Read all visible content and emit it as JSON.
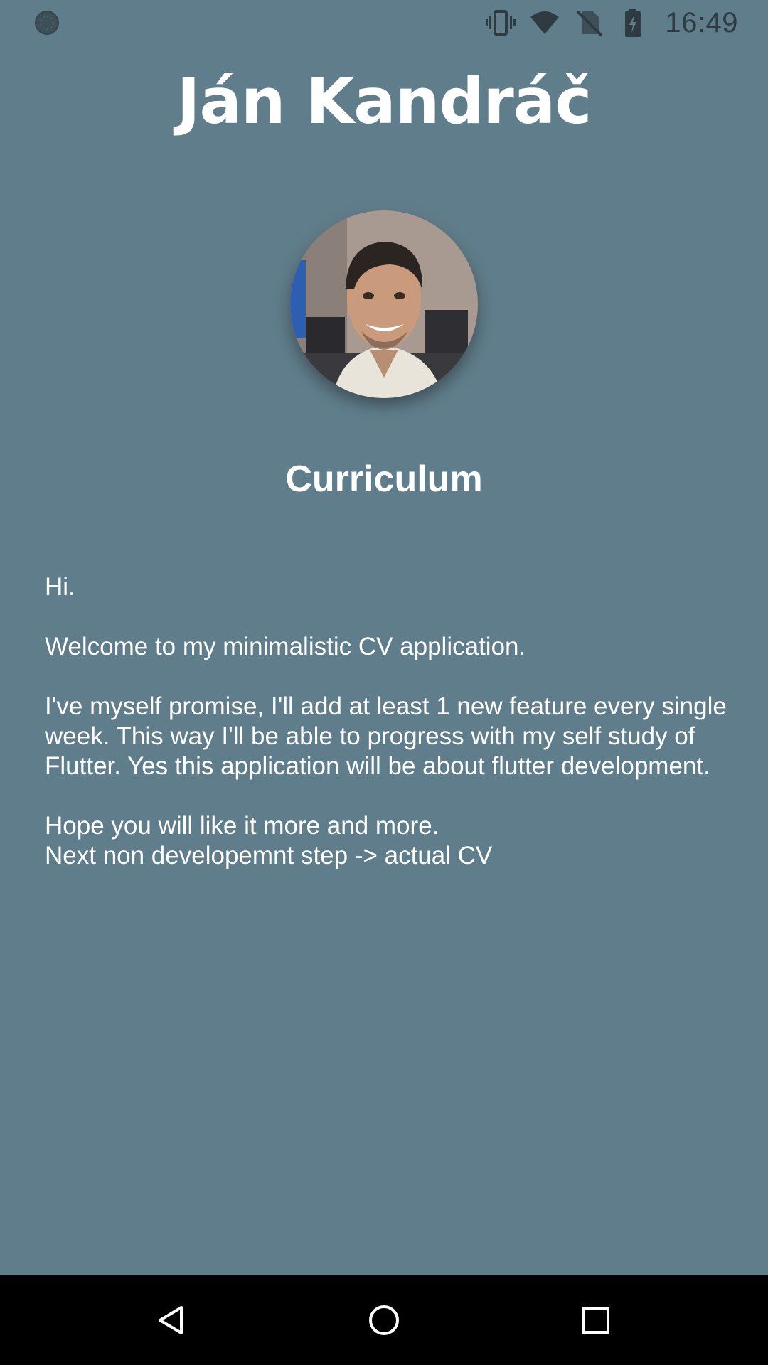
{
  "status_bar": {
    "time": "16:49",
    "left_icon": "activity-indicator-icon",
    "icons": [
      "vibrate-icon",
      "wifi-icon",
      "no-sim-icon",
      "battery-charging-icon"
    ]
  },
  "header": {
    "title": "Ján Kandráč"
  },
  "profile": {
    "avatar": "avatar-photo"
  },
  "section": {
    "title": "Curriculum"
  },
  "intro": {
    "greeting": "Hi.",
    "welcome": "Welcome to my minimalistic CV application.",
    "promise": "I've myself promise, I'll add at least 1 new feature every single week. This way I'll be able to progress with my self study of Flutter. Yes this application will be about flutter development.",
    "hope": "Hope you will like it more and more.",
    "next_step": "Next non developemnt step -> actual CV"
  },
  "nav_bar": {
    "buttons": [
      "back-icon",
      "home-icon",
      "recents-icon"
    ]
  },
  "colors": {
    "background": "#607d8b",
    "status_icons": "#2f3b42",
    "text": "#ffffff",
    "nav_bar": "#000000"
  }
}
